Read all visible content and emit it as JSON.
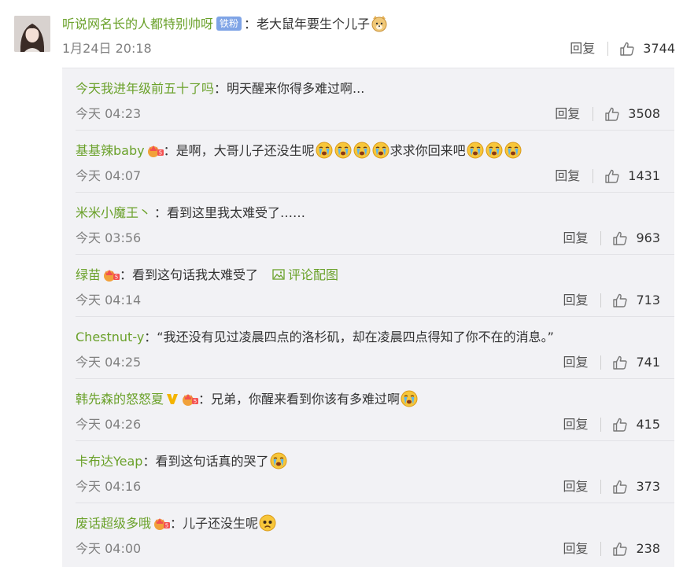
{
  "main_comment": {
    "username": "听说网名长的人都特别帅呀",
    "badge": "铁粉",
    "separator": "：",
    "text": "老大鼠年要生个儿子",
    "time": "1月24日 20:18",
    "reply_label": "回复",
    "likes": "3744"
  },
  "replies": [
    {
      "username": "今天我进年级前五十了吗",
      "sep": "：",
      "text": "明天醒来你得多难过啊...",
      "time": "今天 04:23",
      "reply_label": "回复",
      "likes": "3508"
    },
    {
      "username": "基基辣baby",
      "sep": "：",
      "text": "是啊，大哥儿子还没生呢",
      "text2": "求求你回来吧",
      "time": "今天 04:07",
      "reply_label": "回复",
      "likes": "1431"
    },
    {
      "username": "米米小魔王丶",
      "sep": "：",
      "text": "看到这里我太难受了……",
      "time": "今天 03:56",
      "reply_label": "回复",
      "likes": "963"
    },
    {
      "username": "绿苗",
      "sep": "：",
      "text": "看到这句话我太难受了",
      "pic_link": "评论配图",
      "time": "今天 04:14",
      "reply_label": "回复",
      "likes": "713"
    },
    {
      "username": "Chestnut-y",
      "sep": "：",
      "text": "“我还没有见过凌晨四点的洛杉矶，却在凌晨四点得知了你不在的消息。”",
      "time": "今天 04:25",
      "reply_label": "回复",
      "likes": "741"
    },
    {
      "username": "韩先森的怒怒夏",
      "sep": "：",
      "text": "兄弟，你醒来看到你该有多难过啊",
      "time": "今天 04:26",
      "reply_label": "回复",
      "likes": "415"
    },
    {
      "username": "卡布达Yeap",
      "sep": "：",
      "text": "看到这句话真的哭了",
      "time": "今天 04:16",
      "reply_label": "回复",
      "likes": "373"
    },
    {
      "username": "废话超级多哦",
      "sep": "：",
      "text": "儿子还没生呢",
      "time": "今天 04:00",
      "reply_label": "回复",
      "likes": "238"
    }
  ],
  "colors": {
    "username": "#6aa12a",
    "badge": "#7fa4e6",
    "panel": "#f2f2f5"
  }
}
